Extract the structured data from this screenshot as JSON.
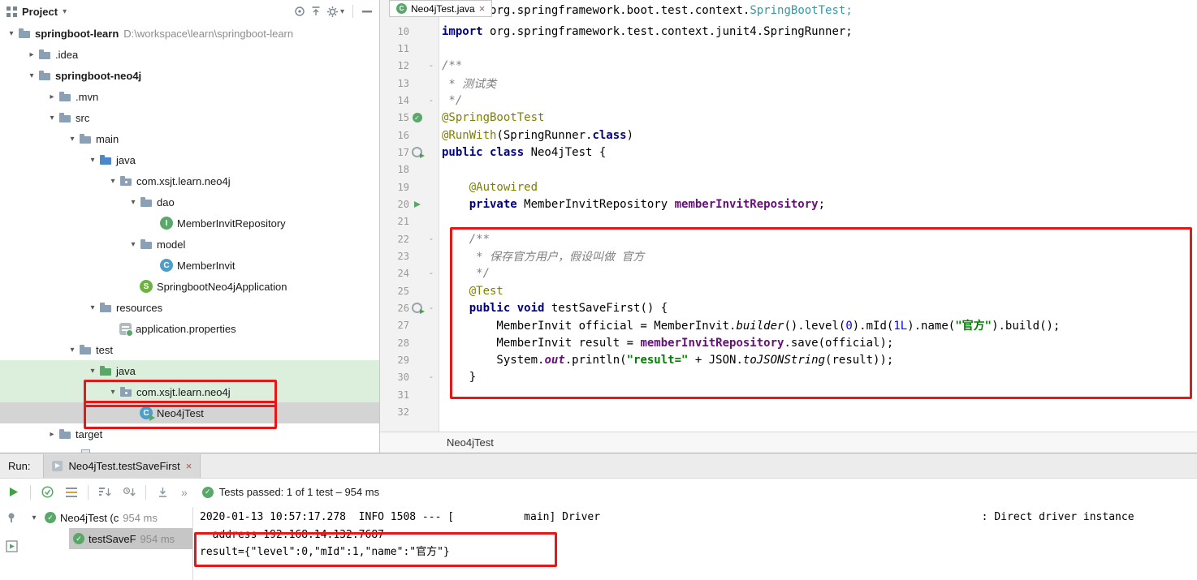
{
  "colors": {
    "annotation_red": "#e51717",
    "test_green": "#59a869",
    "selection_gray": "#d4d4d4",
    "test_source_green_bg": "#dcefdc",
    "keyword_blue": "#000080",
    "string_green": "#008000",
    "field_purple": "#660e7a",
    "annotation_olive": "#808000"
  },
  "project_panel": {
    "title": "Project",
    "tree": [
      {
        "indent": 0,
        "chevron": "open",
        "icon": "folder",
        "label": "springboot-learn",
        "bold": true,
        "suffix": "D:\\workspace\\learn\\springboot-learn"
      },
      {
        "indent": 1,
        "chevron": "closed",
        "icon": "folder",
        "label": ".idea"
      },
      {
        "indent": 1,
        "chevron": "open",
        "icon": "folder",
        "label": "springboot-neo4j",
        "bold": true
      },
      {
        "indent": 2,
        "chevron": "closed",
        "icon": "folder",
        "label": ".mvn"
      },
      {
        "indent": 2,
        "chevron": "open",
        "icon": "folder",
        "label": "src"
      },
      {
        "indent": 3,
        "chevron": "open",
        "icon": "folder",
        "label": "main"
      },
      {
        "indent": 4,
        "chevron": "open",
        "icon": "folder-src",
        "label": "java"
      },
      {
        "indent": 5,
        "chevron": "open",
        "icon": "package",
        "label": "com.xsjt.learn.neo4j"
      },
      {
        "indent": 6,
        "chevron": "open",
        "icon": "folder",
        "label": "dao"
      },
      {
        "indent": 7,
        "chevron": "none",
        "icon": "interface",
        "label": "MemberInvitRepository"
      },
      {
        "indent": 6,
        "chevron": "open",
        "icon": "folder",
        "label": "model"
      },
      {
        "indent": 7,
        "chevron": "none",
        "icon": "class",
        "label": "MemberInvit"
      },
      {
        "indent": 6,
        "chevron": "none",
        "icon": "springboot",
        "label": "SpringbootNeo4jApplication"
      },
      {
        "indent": 4,
        "chevron": "open",
        "icon": "folder",
        "label": "resources"
      },
      {
        "indent": 5,
        "chevron": "none",
        "icon": "properties",
        "label": "application.properties"
      },
      {
        "indent": 3,
        "chevron": "open",
        "icon": "folder",
        "label": "test"
      },
      {
        "indent": 4,
        "chevron": "open",
        "icon": "folder-test",
        "label": "java",
        "bg": "green"
      },
      {
        "indent": 5,
        "chevron": "open",
        "icon": "package",
        "label": "com.xsjt.learn.neo4j",
        "bg": "green"
      },
      {
        "indent": 6,
        "chevron": "none",
        "icon": "class-test",
        "label": "Neo4jTest",
        "bg": "selected"
      },
      {
        "indent": 2,
        "chevron": "closed",
        "icon": "folder",
        "label": "target"
      },
      {
        "indent": 3,
        "chevron": "none",
        "icon": "file",
        "label": ""
      }
    ]
  },
  "editor": {
    "tab_label": "Neo4jTest.java",
    "breadcrumb": "Neo4jTest",
    "fold_lines": [
      12,
      14,
      22,
      24,
      26,
      30
    ],
    "gutter_icons": {
      "15": "test-passed",
      "17": "related",
      "20": "autowired",
      "26": "related"
    },
    "code_lines": [
      {
        "n": 9,
        "segs": [
          [
            "kw",
            "import "
          ],
          [
            "pl",
            "org.springframework.boot.test.context."
          ],
          [
            "cy",
            "SpringBootTest;"
          ]
        ]
      },
      {
        "n": 10,
        "segs": [
          [
            "kw",
            "import "
          ],
          [
            "pl",
            "org.springframework.test.context.junit4.SpringRunner;"
          ]
        ]
      },
      {
        "n": 11,
        "segs": []
      },
      {
        "n": 12,
        "segs": [
          [
            "cm",
            "/**"
          ]
        ]
      },
      {
        "n": 13,
        "segs": [
          [
            "cm",
            " * 测试类"
          ]
        ]
      },
      {
        "n": 14,
        "segs": [
          [
            "cm",
            " */"
          ]
        ]
      },
      {
        "n": 15,
        "segs": [
          [
            "an",
            "@SpringBootTest"
          ]
        ]
      },
      {
        "n": 16,
        "segs": [
          [
            "an",
            "@RunWith"
          ],
          [
            "pl",
            "(SpringRunner."
          ],
          [
            "kw",
            "class"
          ],
          [
            "pl",
            ")"
          ]
        ]
      },
      {
        "n": 17,
        "segs": [
          [
            "kw",
            "public class "
          ],
          [
            "pl",
            "Neo4jTest {"
          ]
        ]
      },
      {
        "n": 18,
        "segs": []
      },
      {
        "n": 19,
        "segs": [
          [
            "pl",
            "    "
          ],
          [
            "an",
            "@Autowired"
          ]
        ]
      },
      {
        "n": 20,
        "segs": [
          [
            "pl",
            "    "
          ],
          [
            "kw",
            "private "
          ],
          [
            "pl",
            "MemberInvitRepository "
          ],
          [
            "fd",
            "memberInvitRepository"
          ],
          [
            "pl",
            ";"
          ]
        ]
      },
      {
        "n": 21,
        "segs": []
      },
      {
        "n": 22,
        "segs": [
          [
            "cm",
            "    /**"
          ]
        ]
      },
      {
        "n": 23,
        "segs": [
          [
            "cm",
            "     * 保存官方用户，假设叫做 官方"
          ]
        ]
      },
      {
        "n": 24,
        "segs": [
          [
            "cm",
            "     */"
          ]
        ]
      },
      {
        "n": 25,
        "segs": [
          [
            "pl",
            "    "
          ],
          [
            "an",
            "@Test"
          ]
        ]
      },
      {
        "n": 26,
        "segs": [
          [
            "pl",
            "    "
          ],
          [
            "kw",
            "public void "
          ],
          [
            "pl",
            "testSaveFirst() {"
          ]
        ]
      },
      {
        "n": 27,
        "segs": [
          [
            "pl",
            "        MemberInvit official = MemberInvit."
          ],
          [
            "it",
            "builder"
          ],
          [
            "pl",
            "().level("
          ],
          [
            "nm",
            "0"
          ],
          [
            "pl",
            ").mId("
          ],
          [
            "nm",
            "1L"
          ],
          [
            "pl",
            ").name("
          ],
          [
            "st",
            "\"官方\""
          ],
          [
            "pl",
            ").build();"
          ]
        ]
      },
      {
        "n": 28,
        "segs": [
          [
            "pl",
            "        MemberInvit result = "
          ],
          [
            "fd",
            "memberInvitRepository"
          ],
          [
            "pl",
            ".save(official);"
          ]
        ]
      },
      {
        "n": 29,
        "segs": [
          [
            "pl",
            "        System."
          ],
          [
            "sf",
            "out"
          ],
          [
            "pl",
            ".println("
          ],
          [
            "st",
            "\"result=\""
          ],
          [
            "pl",
            " + JSON."
          ],
          [
            "it",
            "toJSONString"
          ],
          [
            "pl",
            "(result));"
          ]
        ]
      },
      {
        "n": 30,
        "segs": [
          [
            "pl",
            "    }"
          ]
        ]
      },
      {
        "n": 31,
        "segs": []
      },
      {
        "n": 32,
        "segs": []
      }
    ]
  },
  "run_panel": {
    "run_label": "Run:",
    "tab_label": "Neo4jTest.testSaveFirst",
    "status": "Tests passed: 1 of 1 test – 954 ms",
    "tree": [
      {
        "label": "Neo4jTest (c",
        "time": "954 ms",
        "chevron": "open",
        "selected": false
      },
      {
        "label": "testSaveF",
        "time": "954 ms",
        "selected": true
      }
    ],
    "console": [
      "2020-01-13 10:57:17.278  INFO 1508 --- [           main] Driver                                                            : Direct driver instance",
      "  address 192.168.14.132:7687",
      "result={\"level\":0,\"mId\":1,\"name\":\"官方\"}"
    ]
  }
}
